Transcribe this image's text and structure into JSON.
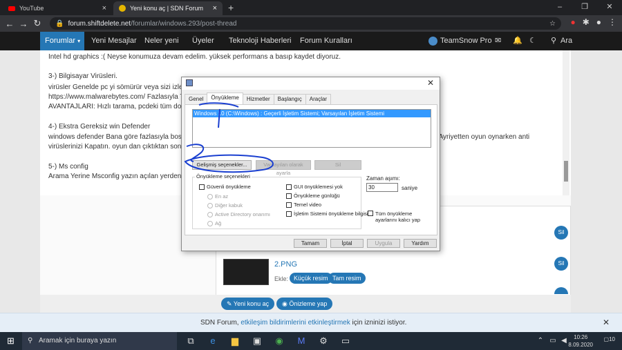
{
  "browser": {
    "tabs": [
      {
        "label": "YouTube",
        "icon": "youtube-icon"
      },
      {
        "label": "Yeni konu aç | SDN Forum",
        "icon": "sdn-icon"
      }
    ],
    "url_host": "forum.shiftdelete.net",
    "url_path": "/forumlar/windows.293/post-thread"
  },
  "sitenav": {
    "forumlar": "Forumlar",
    "items": [
      "Yeni Mesajlar",
      "Neler yeni",
      "Üyeler",
      "Teknoloji Haberleri",
      "Forum Kuralları"
    ],
    "user": "TeamSnow Pro",
    "search": "Ara"
  },
  "content": {
    "lines": [
      "Intel hd graphics :( Neyse konumuza devam edelim. yüksek performans a basıp kaydet diyoruz.",
      "3-) Bilgisayar Virüsleri.",
      "virüsler Genelde pc yi sömürür veya sizi izler",
      "https://www.malwarebytes.com/ Fazlasıyla T",
      "AVANTAJLARI: Hızlı tarama, pcdeki tüm dos",
      "4-) Ekstra Gereksiz win Defender",
      "windows defender Bana göre fazlasıyla bos",
      "virüslerinizi Kapatın. oyun dan çıktıktan sonra",
      "5-) Ms config",
      "Arama Yerine Msconfig yazın açılan yerden:",
      "n. Ayriyetten oyun oynarken anti"
    ]
  },
  "attachments": {
    "file2": "2.PNG",
    "ekle": "Ekle:",
    "small": "Küçük resim",
    "full": "Tam resim",
    "delete": "Sil"
  },
  "postbar": {
    "new_thread": "Yeni konu aç",
    "preview": "Önizleme yap"
  },
  "notice": {
    "pre": "SDN Forum, ",
    "link": "etkileşim bildirimlerini etkinleştirmek",
    "post": " için izninizi istiyor."
  },
  "taskbar": {
    "search": "Aramak için buraya yazın",
    "time": "10:26",
    "date": "8.09.2020",
    "badge": "10"
  },
  "dialog": {
    "tabs": [
      "Genel",
      "Önyükleme",
      "Hizmetler",
      "Başlangıç",
      "Araçlar"
    ],
    "os_entry": "Windows 10 (C:\\Windows) : Geçerli İşletim Sistemi; Varsayılan İşletim Sistemi",
    "advanced": "Gelişmiş seçenekler...",
    "set_default": "Varsayılan olarak ayarla",
    "delete": "Sil",
    "boot_options": "Önyükleme seçenekleri",
    "safe_boot": "Güvenli önyükleme",
    "minimal": "En az",
    "alt_shell": "Diğer kabuk",
    "ad_repair": "Active Directory onarımı",
    "network": "Ağ",
    "no_gui": "GUI önyüklemesi yok",
    "boot_log": "Önyükleme günlüğü",
    "base_video": "Temel video",
    "os_info": "İşletim Sistemi önyükleme bilgisi",
    "timeout_label": "Zaman aşımı:",
    "timeout_value": "30",
    "seconds": "saniye",
    "make_perm": "Tüm önyükleme ayarlarını kalıcı yap",
    "ok": "Tamam",
    "cancel": "İptal",
    "apply": "Uygula",
    "help": "Yardım"
  }
}
